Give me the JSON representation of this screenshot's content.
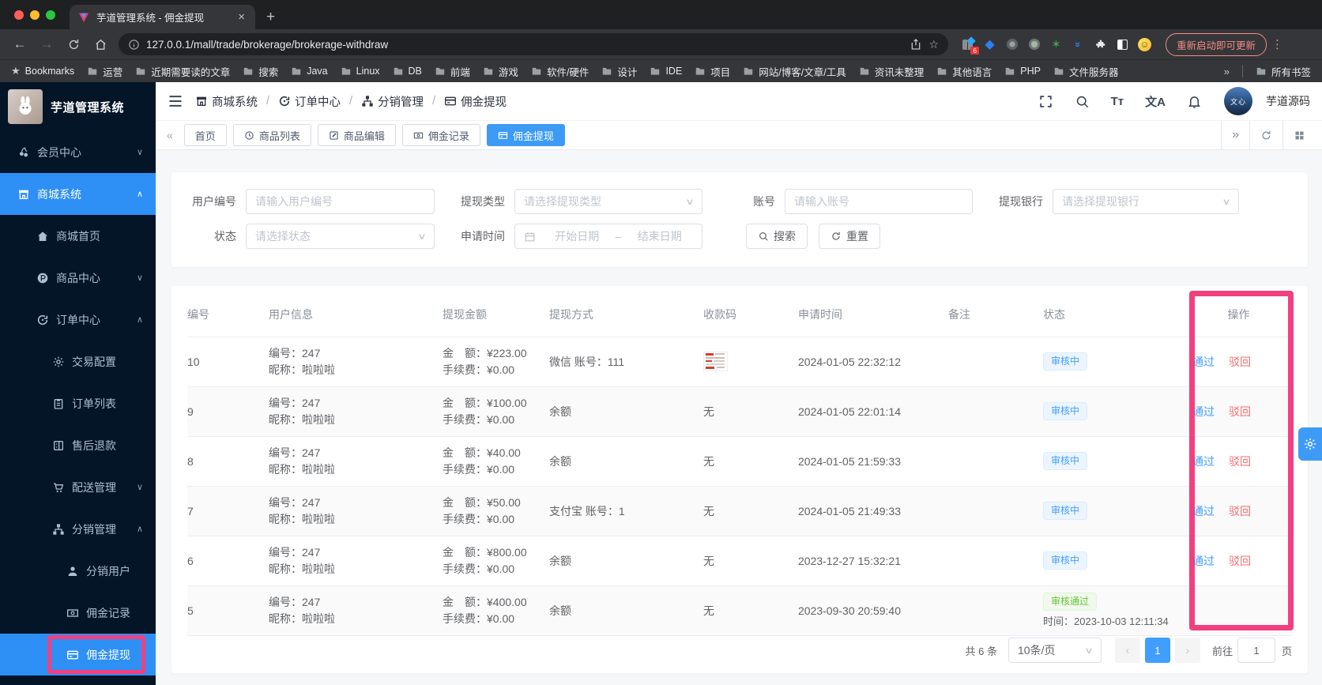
{
  "browser": {
    "tab_title": "芋道管理系统 - 佣金提现",
    "url": "127.0.0.1/mall/trade/brokerage/brokerage-withdraw",
    "update_button": "重新启动即可更新",
    "extension_badge": "6",
    "bookmarks_root": "Bookmarks",
    "folders": [
      "运营",
      "近期需要读的文章",
      "搜索",
      "Java",
      "Linux",
      "DB",
      "前端",
      "游戏",
      "软件/硬件",
      "设计",
      "IDE",
      "项目",
      "网站/博客/文章/工具",
      "资讯未整理",
      "其他语言",
      "PHP",
      "文件服务器"
    ],
    "all_bookmarks": "所有书签"
  },
  "icons": {
    "back": "←",
    "forward": "→",
    "close": "×",
    "new_tab": "+",
    "more": "⋮",
    "collapse": "«",
    "expand": "»",
    "prev": "‹",
    "next": "›",
    "chevron_down": "∨",
    "chevron_up": "∧",
    "font_size": "Tт",
    "language": "文A",
    "emoji_face": "☺",
    "star": "★"
  },
  "sidebar": {
    "title": "芋道管理系统",
    "items": [
      {
        "label": "会员中心"
      },
      {
        "label": "商城系统"
      },
      {
        "label": "商城首页"
      },
      {
        "label": "商品中心"
      },
      {
        "label": "订单中心"
      },
      {
        "label": "交易配置"
      },
      {
        "label": "订单列表"
      },
      {
        "label": "售后退款"
      },
      {
        "label": "配送管理"
      },
      {
        "label": "分销管理"
      },
      {
        "label": "分销用户"
      },
      {
        "label": "佣金记录"
      },
      {
        "label": "佣金提现"
      }
    ]
  },
  "header": {
    "breadcrumb": [
      {
        "label": "商城系统"
      },
      {
        "label": "订单中心"
      },
      {
        "label": "分销管理"
      },
      {
        "label": "佣金提现"
      }
    ],
    "avatar_text": "文心",
    "username": "芋道源码"
  },
  "tabs": {
    "items": [
      {
        "label": "首页"
      },
      {
        "label": "商品列表"
      },
      {
        "label": "商品编辑"
      },
      {
        "label": "佣金记录"
      },
      {
        "label": "佣金提现"
      }
    ]
  },
  "filters": {
    "user_no": {
      "label": "用户编号",
      "placeholder": "请输入用户编号"
    },
    "type": {
      "label": "提现类型",
      "placeholder": "请选择提现类型"
    },
    "account": {
      "label": "账号",
      "placeholder": "请输入账号"
    },
    "bank": {
      "label": "提现银行",
      "placeholder": "请选择提现银行"
    },
    "status": {
      "label": "状态",
      "placeholder": "请选择状态"
    },
    "time": {
      "label": "申请时间",
      "start": "开始日期",
      "separator": "–",
      "end": "结束日期"
    },
    "search_label": "搜索",
    "reset_label": "重置"
  },
  "table": {
    "columns": [
      "编号",
      "用户信息",
      "提现金额",
      "提现方式",
      "收款码",
      "申请时间",
      "备注",
      "状态",
      "操作"
    ],
    "labels": {
      "user_no": "编号：",
      "nickname": "昵称：",
      "amount": "金　额：",
      "fee": "手续费：",
      "audit_time": "时间："
    },
    "rows": [
      {
        "id": "10",
        "user_no": "247",
        "nickname": "啦啦啦",
        "amount": "¥223.00",
        "fee": "¥0.00",
        "method": "微信 账号：111",
        "payee": "",
        "time": "2024-01-05 22:32:12",
        "remark": "",
        "status": "审核中",
        "approve": "通过",
        "reject": "驳回"
      },
      {
        "id": "9",
        "user_no": "247",
        "nickname": "啦啦啦",
        "amount": "¥100.00",
        "fee": "¥0.00",
        "method": "余额",
        "payee": "无",
        "time": "2024-01-05 22:01:14",
        "remark": "",
        "status": "审核中",
        "approve": "通过",
        "reject": "驳回"
      },
      {
        "id": "8",
        "user_no": "247",
        "nickname": "啦啦啦",
        "amount": "¥40.00",
        "fee": "¥0.00",
        "method": "余额",
        "payee": "无",
        "time": "2024-01-05 21:59:33",
        "remark": "",
        "status": "审核中",
        "approve": "通过",
        "reject": "驳回"
      },
      {
        "id": "7",
        "user_no": "247",
        "nickname": "啦啦啦",
        "amount": "¥50.00",
        "fee": "¥0.00",
        "method": "支付宝 账号：1",
        "payee": "无",
        "time": "2024-01-05 21:49:33",
        "remark": "",
        "status": "审核中",
        "approve": "通过",
        "reject": "驳回"
      },
      {
        "id": "6",
        "user_no": "247",
        "nickname": "啦啦啦",
        "amount": "¥800.00",
        "fee": "¥0.00",
        "method": "余额",
        "payee": "无",
        "time": "2023-12-27 15:32:21",
        "remark": "",
        "status": "审核中",
        "approve": "通过",
        "reject": "驳回"
      },
      {
        "id": "5",
        "user_no": "247",
        "nickname": "啦啦啦",
        "amount": "¥400.00",
        "fee": "¥0.00",
        "method": "余额",
        "payee": "无",
        "time": "2023-09-30 20:59:40",
        "remark": "",
        "status": "审核通过",
        "audit_time": "2023-10-03 12:11:34"
      }
    ]
  },
  "pagination": {
    "total": "共 6 条",
    "size": "10条/页",
    "page": "1",
    "goto": "前往",
    "goto_value": "1",
    "unit": "页"
  }
}
